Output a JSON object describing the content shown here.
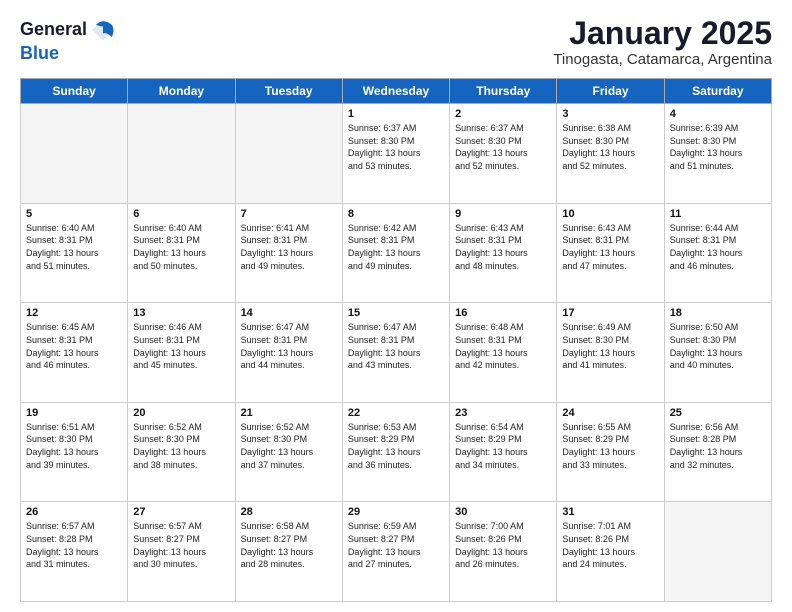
{
  "header": {
    "logo_general": "General",
    "logo_blue": "Blue",
    "month_title": "January 2025",
    "location": "Tinogasta, Catamarca, Argentina"
  },
  "days_of_week": [
    "Sunday",
    "Monday",
    "Tuesday",
    "Wednesday",
    "Thursday",
    "Friday",
    "Saturday"
  ],
  "weeks": [
    [
      {
        "day": "",
        "text": ""
      },
      {
        "day": "",
        "text": ""
      },
      {
        "day": "",
        "text": ""
      },
      {
        "day": "1",
        "text": "Sunrise: 6:37 AM\nSunset: 8:30 PM\nDaylight: 13 hours\nand 53 minutes."
      },
      {
        "day": "2",
        "text": "Sunrise: 6:37 AM\nSunset: 8:30 PM\nDaylight: 13 hours\nand 52 minutes."
      },
      {
        "day": "3",
        "text": "Sunrise: 6:38 AM\nSunset: 8:30 PM\nDaylight: 13 hours\nand 52 minutes."
      },
      {
        "day": "4",
        "text": "Sunrise: 6:39 AM\nSunset: 8:30 PM\nDaylight: 13 hours\nand 51 minutes."
      }
    ],
    [
      {
        "day": "5",
        "text": "Sunrise: 6:40 AM\nSunset: 8:31 PM\nDaylight: 13 hours\nand 51 minutes."
      },
      {
        "day": "6",
        "text": "Sunrise: 6:40 AM\nSunset: 8:31 PM\nDaylight: 13 hours\nand 50 minutes."
      },
      {
        "day": "7",
        "text": "Sunrise: 6:41 AM\nSunset: 8:31 PM\nDaylight: 13 hours\nand 49 minutes."
      },
      {
        "day": "8",
        "text": "Sunrise: 6:42 AM\nSunset: 8:31 PM\nDaylight: 13 hours\nand 49 minutes."
      },
      {
        "day": "9",
        "text": "Sunrise: 6:43 AM\nSunset: 8:31 PM\nDaylight: 13 hours\nand 48 minutes."
      },
      {
        "day": "10",
        "text": "Sunrise: 6:43 AM\nSunset: 8:31 PM\nDaylight: 13 hours\nand 47 minutes."
      },
      {
        "day": "11",
        "text": "Sunrise: 6:44 AM\nSunset: 8:31 PM\nDaylight: 13 hours\nand 46 minutes."
      }
    ],
    [
      {
        "day": "12",
        "text": "Sunrise: 6:45 AM\nSunset: 8:31 PM\nDaylight: 13 hours\nand 46 minutes."
      },
      {
        "day": "13",
        "text": "Sunrise: 6:46 AM\nSunset: 8:31 PM\nDaylight: 13 hours\nand 45 minutes."
      },
      {
        "day": "14",
        "text": "Sunrise: 6:47 AM\nSunset: 8:31 PM\nDaylight: 13 hours\nand 44 minutes."
      },
      {
        "day": "15",
        "text": "Sunrise: 6:47 AM\nSunset: 8:31 PM\nDaylight: 13 hours\nand 43 minutes."
      },
      {
        "day": "16",
        "text": "Sunrise: 6:48 AM\nSunset: 8:31 PM\nDaylight: 13 hours\nand 42 minutes."
      },
      {
        "day": "17",
        "text": "Sunrise: 6:49 AM\nSunset: 8:30 PM\nDaylight: 13 hours\nand 41 minutes."
      },
      {
        "day": "18",
        "text": "Sunrise: 6:50 AM\nSunset: 8:30 PM\nDaylight: 13 hours\nand 40 minutes."
      }
    ],
    [
      {
        "day": "19",
        "text": "Sunrise: 6:51 AM\nSunset: 8:30 PM\nDaylight: 13 hours\nand 39 minutes."
      },
      {
        "day": "20",
        "text": "Sunrise: 6:52 AM\nSunset: 8:30 PM\nDaylight: 13 hours\nand 38 minutes."
      },
      {
        "day": "21",
        "text": "Sunrise: 6:52 AM\nSunset: 8:30 PM\nDaylight: 13 hours\nand 37 minutes."
      },
      {
        "day": "22",
        "text": "Sunrise: 6:53 AM\nSunset: 8:29 PM\nDaylight: 13 hours\nand 36 minutes."
      },
      {
        "day": "23",
        "text": "Sunrise: 6:54 AM\nSunset: 8:29 PM\nDaylight: 13 hours\nand 34 minutes."
      },
      {
        "day": "24",
        "text": "Sunrise: 6:55 AM\nSunset: 8:29 PM\nDaylight: 13 hours\nand 33 minutes."
      },
      {
        "day": "25",
        "text": "Sunrise: 6:56 AM\nSunset: 8:28 PM\nDaylight: 13 hours\nand 32 minutes."
      }
    ],
    [
      {
        "day": "26",
        "text": "Sunrise: 6:57 AM\nSunset: 8:28 PM\nDaylight: 13 hours\nand 31 minutes."
      },
      {
        "day": "27",
        "text": "Sunrise: 6:57 AM\nSunset: 8:27 PM\nDaylight: 13 hours\nand 30 minutes."
      },
      {
        "day": "28",
        "text": "Sunrise: 6:58 AM\nSunset: 8:27 PM\nDaylight: 13 hours\nand 28 minutes."
      },
      {
        "day": "29",
        "text": "Sunrise: 6:59 AM\nSunset: 8:27 PM\nDaylight: 13 hours\nand 27 minutes."
      },
      {
        "day": "30",
        "text": "Sunrise: 7:00 AM\nSunset: 8:26 PM\nDaylight: 13 hours\nand 26 minutes."
      },
      {
        "day": "31",
        "text": "Sunrise: 7:01 AM\nSunset: 8:26 PM\nDaylight: 13 hours\nand 24 minutes."
      },
      {
        "day": "",
        "text": ""
      }
    ]
  ]
}
